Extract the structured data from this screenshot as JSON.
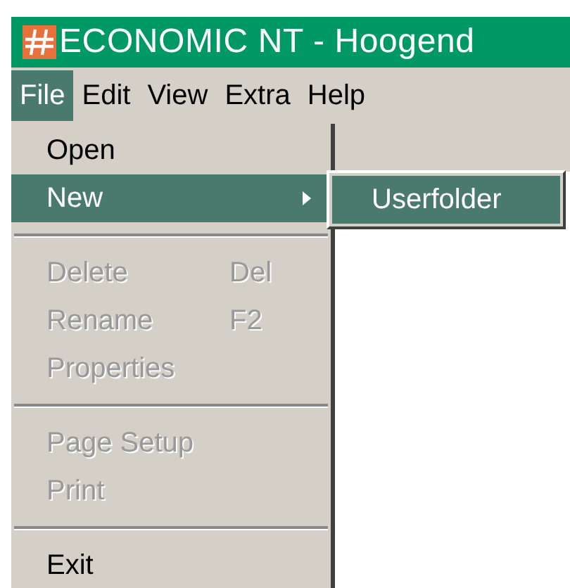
{
  "window": {
    "title": "ECONOMIC NT - Hoogend"
  },
  "menu_bar": [
    {
      "label": "File",
      "selected": true
    },
    {
      "label": "Edit",
      "selected": false
    },
    {
      "label": "View",
      "selected": false
    },
    {
      "label": "Extra",
      "selected": false
    },
    {
      "label": "Help",
      "selected": false
    }
  ],
  "file_menu": [
    {
      "kind": "item",
      "label": "Open",
      "disabled": false,
      "selected": false,
      "submenu": false
    },
    {
      "kind": "item",
      "label": "New",
      "disabled": false,
      "selected": true,
      "submenu": true
    },
    {
      "kind": "separator"
    },
    {
      "kind": "item",
      "label": "Delete",
      "shortcut": "Del",
      "disabled": true,
      "selected": false,
      "submenu": false
    },
    {
      "kind": "item",
      "label": "Rename",
      "shortcut": "F2",
      "disabled": true,
      "selected": false,
      "submenu": false
    },
    {
      "kind": "item",
      "label": "Properties",
      "disabled": true,
      "selected": false,
      "submenu": false
    },
    {
      "kind": "separator"
    },
    {
      "kind": "item",
      "label": "Page Setup",
      "disabled": true,
      "selected": false,
      "submenu": false
    },
    {
      "kind": "item",
      "label": "Print",
      "disabled": true,
      "selected": false,
      "submenu": false
    },
    {
      "kind": "separator"
    },
    {
      "kind": "item",
      "label": "Exit",
      "disabled": false,
      "selected": false,
      "submenu": false
    }
  ],
  "new_submenu": [
    {
      "label": "Userfolder",
      "selected": true
    }
  ]
}
